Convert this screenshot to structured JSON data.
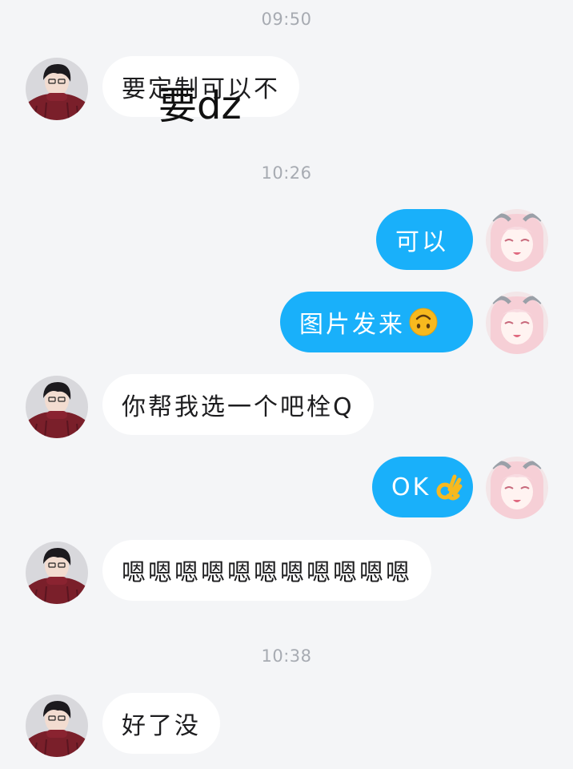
{
  "messages": [
    {
      "kind": "time",
      "text": "09:50"
    },
    {
      "kind": "in",
      "text": "要定制可以不",
      "overlay": "要dz"
    },
    {
      "kind": "time",
      "text": "10:26"
    },
    {
      "kind": "out",
      "text": "可以"
    },
    {
      "kind": "out",
      "text": "图片发来",
      "emoji": "upside-down-face"
    },
    {
      "kind": "in",
      "text": "你帮我选一个吧栓Q"
    },
    {
      "kind": "out",
      "text": "OK",
      "emoji": "ok-hand"
    },
    {
      "kind": "in",
      "text": "嗯嗯嗯嗯嗯嗯嗯嗯嗯嗯嗯"
    },
    {
      "kind": "time",
      "text": "10:38"
    },
    {
      "kind": "in",
      "text": "好了没"
    }
  ],
  "colors": {
    "background": "#f4f5f7",
    "incoming_bubble": "#ffffff",
    "outgoing_bubble": "#19b0fa",
    "timestamp_text": "#a7abb2"
  },
  "avatars": {
    "contact": "dark-hair-boy-avatar",
    "self": "pink-hair-girl-avatar"
  }
}
